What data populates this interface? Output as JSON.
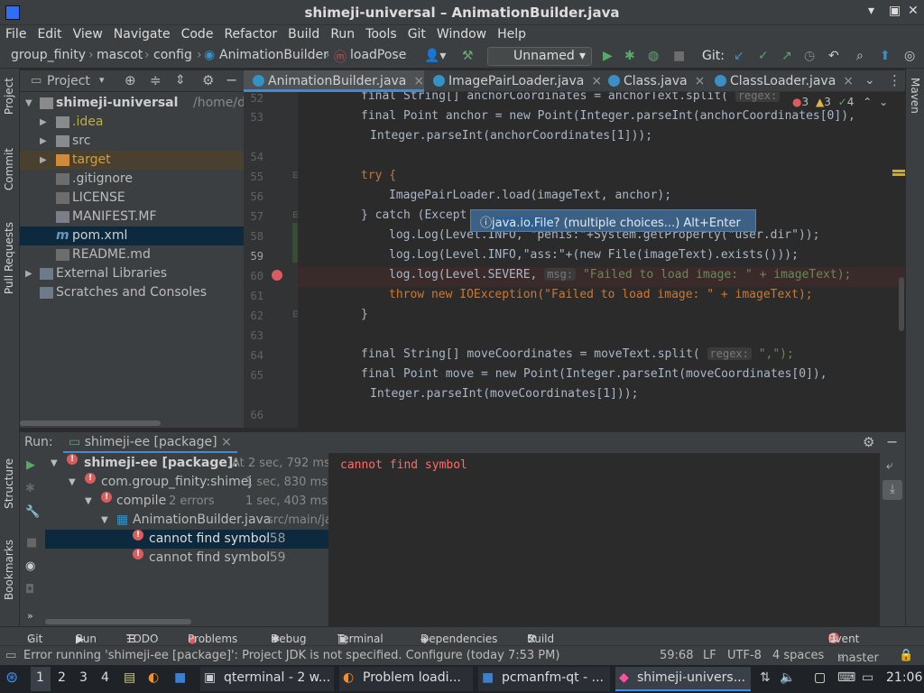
{
  "window": {
    "title": "shimeji-universal – AnimationBuilder.java"
  },
  "menu": [
    "File",
    "Edit",
    "View",
    "Navigate",
    "Code",
    "Refactor",
    "Build",
    "Run",
    "Tools",
    "Git",
    "Window",
    "Help"
  ],
  "breadcrumb": [
    "group_finity",
    "mascot",
    "config",
    "AnimationBuilder",
    "loadPose"
  ],
  "run_config": "Unnamed",
  "git_label": "Git:",
  "project": {
    "title": "Project",
    "items": [
      {
        "label": "shimeji-universal",
        "extra": "/home/dartz"
      },
      {
        "label": ".idea"
      },
      {
        "label": "src"
      },
      {
        "label": "target"
      },
      {
        "label": ".gitignore"
      },
      {
        "label": "LICENSE"
      },
      {
        "label": "MANIFEST.MF"
      },
      {
        "label": "pom.xml"
      },
      {
        "label": "README.md"
      },
      {
        "label": "External Libraries"
      },
      {
        "label": "Scratches and Consoles"
      }
    ]
  },
  "left_tools": [
    "Project",
    "Commit",
    "Pull Requests",
    "Structure",
    "Bookmarks"
  ],
  "right_tools": [
    "Maven"
  ],
  "tabs": [
    "AnimationBuilder.java",
    "ImagePairLoader.java",
    "Class.java",
    "ClassLoader.java"
  ],
  "inspections": {
    "errors": "3",
    "warnings": "3",
    "ok": "4"
  },
  "editor": {
    "line_numbers": [
      "52",
      "53",
      "",
      "54",
      "55",
      "56",
      "57",
      "58",
      "59",
      "60",
      "61",
      "62",
      "63",
      "64",
      "65",
      "",
      "66"
    ],
    "top_line": "final String[] anchorCoordinates = anchorText.split(",
    "hint_regex": "regex:",
    "l53a": "final Point anchor = new Point(Integer.parseInt(anchorCoordinates[0]),",
    "l53b": "Integer.parseInt(anchorCoordinates[1]));",
    "l55": "try {",
    "l56": "ImagePairLoader.load(imageText, anchor);",
    "l57": "} catch (Except",
    "l58": "log.Log(Level.INFO, \"penis:\"+System.getProperty(\"user.dir\"));",
    "l59": "log.Log(Level.INFO,\"ass:\"+(new File(imageText).exists()));",
    "l60a": "log.log(Level.SEVERE,",
    "hint_msg": "msg:",
    "l60b": "\"Failed to load image: \" + imageText);",
    "l61": "throw new IOException(\"Failed to load image: \" + imageText);",
    "l62": "}",
    "l64": "final String[] moveCoordinates = moveText.split(",
    "l64b": "\",\");",
    "l65a": "final Point move = new Point(Integer.parseInt(moveCoordinates[0]),",
    "l65b": "Integer.parseInt(moveCoordinates[1]));"
  },
  "popup": {
    "cls": "java.io.File",
    "rest": "? (multiple choices...) Alt+Enter"
  },
  "run_panel": {
    "label": "Run:",
    "tab": "shimeji-ee [package]",
    "rows": [
      {
        "label": "shimeji-ee [package]:",
        "meta": "At 2 sec, 792 ms"
      },
      {
        "label": "com.group_finity:shimej",
        "meta": "1 sec, 830 ms"
      },
      {
        "label": "compile",
        "meta": "2 errors",
        "time": "1 sec, 403 ms"
      },
      {
        "label": "AnimationBuilder.java",
        "meta": "src/main/ja"
      },
      {
        "label": "cannot find symbol",
        "meta": ":58"
      },
      {
        "label": "cannot find symbol",
        "meta": ":59"
      }
    ],
    "output": "cannot find symbol"
  },
  "bottom_tabs": [
    "Git",
    "Run",
    "TODO",
    "Problems",
    "Debug",
    "Terminal",
    "Dependencies",
    "Build",
    "Event Log"
  ],
  "status": {
    "message": "Error running 'shimeji-ee [package]': Project JDK is not specified. Configure (today 7:53 PM)",
    "position": "59:68",
    "line_sep": "LF",
    "encoding": "UTF-8",
    "indent": "4 spaces",
    "branch": "master"
  },
  "taskbar": {
    "workspaces": [
      "1",
      "2",
      "3",
      "4"
    ],
    "windows": [
      "qterminal - 2 w...",
      "Problem loadi...",
      "pcmanfm-qt - ...",
      "shimeji-univers..."
    ],
    "clock": "21:06"
  }
}
